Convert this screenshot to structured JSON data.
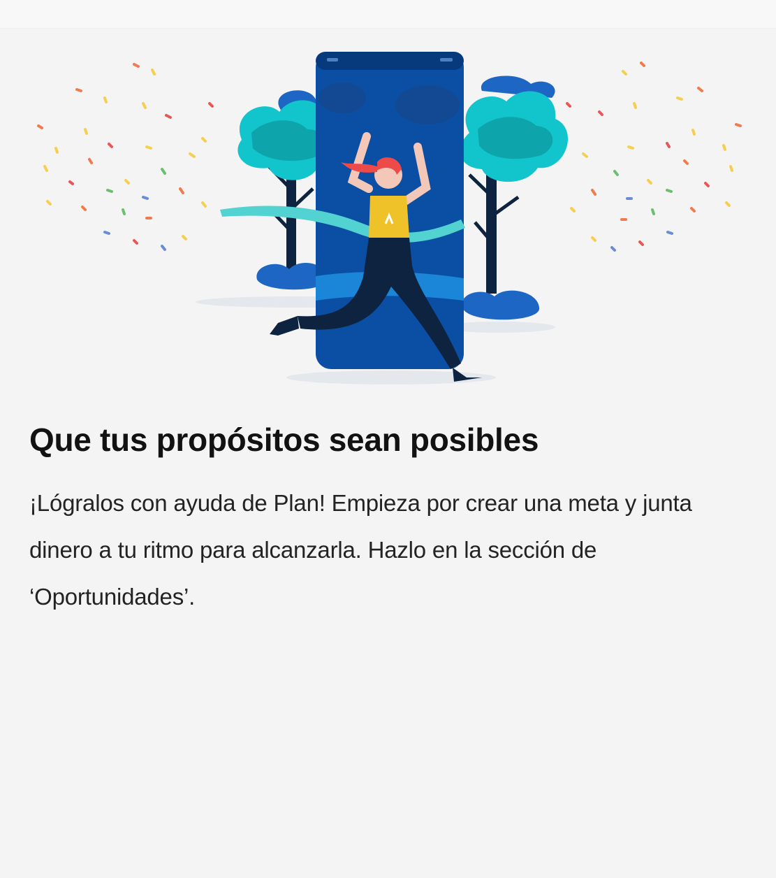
{
  "card": {
    "title": "Que tus propósitos sean posibles",
    "body": "¡Lógralos con ayuda de Plan! Empieza por crear una meta y junta dinero a tu ritmo para alcanzarla. Hazlo en la sección de ‘Oportunidades’."
  },
  "illustration": {
    "subject": "runner-crossing-finish-line-phone-illustration",
    "colors": {
      "phone": "#0a4fa3",
      "phone_dark": "#063a7c",
      "tree_teal": "#12c4cc",
      "tree_dark": "#0b8b91",
      "bush_blue": "#1d66c4",
      "ribbon": "#52d2d0",
      "vest": "#f0c22a",
      "hair": "#ef4a4a",
      "pants": "#0e2340"
    }
  }
}
